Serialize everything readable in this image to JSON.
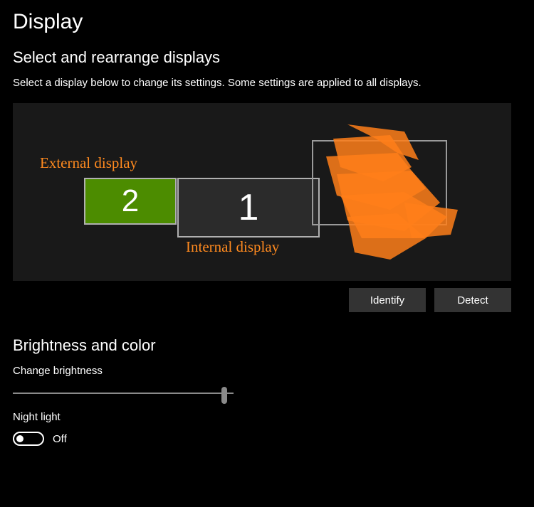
{
  "page": {
    "title": "Display"
  },
  "arrange": {
    "heading": "Select and rearrange displays",
    "description": "Select a display below to change its settings. Some settings are applied to all displays.",
    "displays": {
      "d1": {
        "number": "1"
      },
      "d2": {
        "number": "2"
      }
    },
    "annotations": {
      "external": "External display",
      "internal": "Internal display"
    },
    "buttons": {
      "identify": "Identify",
      "detect": "Detect"
    }
  },
  "brightness": {
    "heading": "Brightness and color",
    "change_label": "Change brightness",
    "slider_percent": 97,
    "night_light_label": "Night light",
    "night_light_state": "Off"
  }
}
